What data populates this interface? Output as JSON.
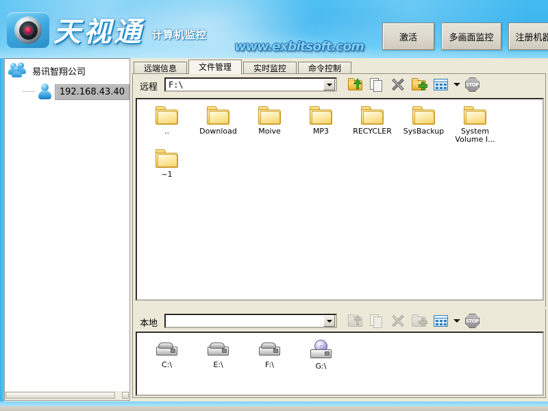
{
  "header": {
    "logo_icon": "camera-lens-icon",
    "brand": "天视通",
    "brand_sub": "计算机监控",
    "website": "www.exbitsoft.com",
    "buttons": [
      {
        "label": "激活",
        "name": "activate-button"
      },
      {
        "label": "多画面监控",
        "name": "multi-view-monitor-button"
      },
      {
        "label": "注册机器数",
        "name": "register-machine-count-button"
      }
    ]
  },
  "sidebar": {
    "group_icon": "group-users-icon",
    "group_label": "易讯智翔公司",
    "client_icon": "user-icon",
    "client_ip": "192.168.43.40"
  },
  "main": {
    "tabs": [
      {
        "label": "远端信息",
        "name": "tab-remote-info",
        "active": false
      },
      {
        "label": "文件管理",
        "name": "tab-file-manager",
        "active": true
      },
      {
        "label": "实时监控",
        "name": "tab-live-monitor",
        "active": false
      },
      {
        "label": "命令控制",
        "name": "tab-command-control",
        "active": false
      }
    ],
    "remote": {
      "label": "远程",
      "path_value": "F:\\",
      "path_placeholder": "",
      "toolbar": [
        {
          "name": "open-folder-up-icon",
          "label": "上级目录",
          "disabled": false
        },
        {
          "name": "copy-files-icon",
          "label": "复制",
          "disabled": false
        },
        {
          "name": "delete-x-icon",
          "label": "删除",
          "disabled": false
        },
        {
          "name": "new-folder-icon",
          "label": "新建文件夹",
          "disabled": false
        },
        {
          "name": "view-mode-grid-icon",
          "label": "查看方式",
          "disabled": false
        },
        {
          "name": "chevron-down-icon",
          "label": "更多",
          "disabled": false
        },
        {
          "name": "stop-icon",
          "label": "STOP",
          "disabled": false
        }
      ],
      "items": [
        {
          "icon": "folder-icon",
          "label": ".."
        },
        {
          "icon": "folder-icon",
          "label": "Download"
        },
        {
          "icon": "folder-icon",
          "label": "Moive"
        },
        {
          "icon": "folder-icon",
          "label": "MP3"
        },
        {
          "icon": "folder-icon",
          "label": "RECYCLER"
        },
        {
          "icon": "folder-icon",
          "label": "SysBackup"
        },
        {
          "icon": "folder-icon",
          "label": "System Volume I..."
        },
        {
          "icon": "folder-icon",
          "label": "~1"
        }
      ]
    },
    "local": {
      "label": "本地",
      "path_value": "",
      "path_placeholder": "",
      "toolbar": [
        {
          "name": "open-folder-up-icon",
          "label": "上级目录",
          "disabled": true
        },
        {
          "name": "copy-files-icon",
          "label": "复制",
          "disabled": true
        },
        {
          "name": "delete-x-icon",
          "label": "删除",
          "disabled": true
        },
        {
          "name": "new-folder-icon",
          "label": "新建文件夹",
          "disabled": true
        },
        {
          "name": "view-mode-grid-icon",
          "label": "查看方式",
          "disabled": false
        },
        {
          "name": "chevron-down-icon",
          "label": "更多",
          "disabled": false
        },
        {
          "name": "stop-icon",
          "label": "STOP",
          "disabled": false
        }
      ],
      "items": [
        {
          "icon": "hard-drive-icon",
          "label": "C:\\"
        },
        {
          "icon": "hard-drive-icon",
          "label": "E:\\"
        },
        {
          "icon": "hard-drive-icon",
          "label": "F:\\"
        },
        {
          "icon": "cd-drive-icon",
          "label": "G:\\"
        }
      ]
    }
  },
  "stop_label": "STOP",
  "colors": {
    "header_blue": "#3db5ef",
    "panel_face": "#ece9d8",
    "selection_gray": "#b8b8b8",
    "folder_yellow": "#f5cb5c"
  }
}
